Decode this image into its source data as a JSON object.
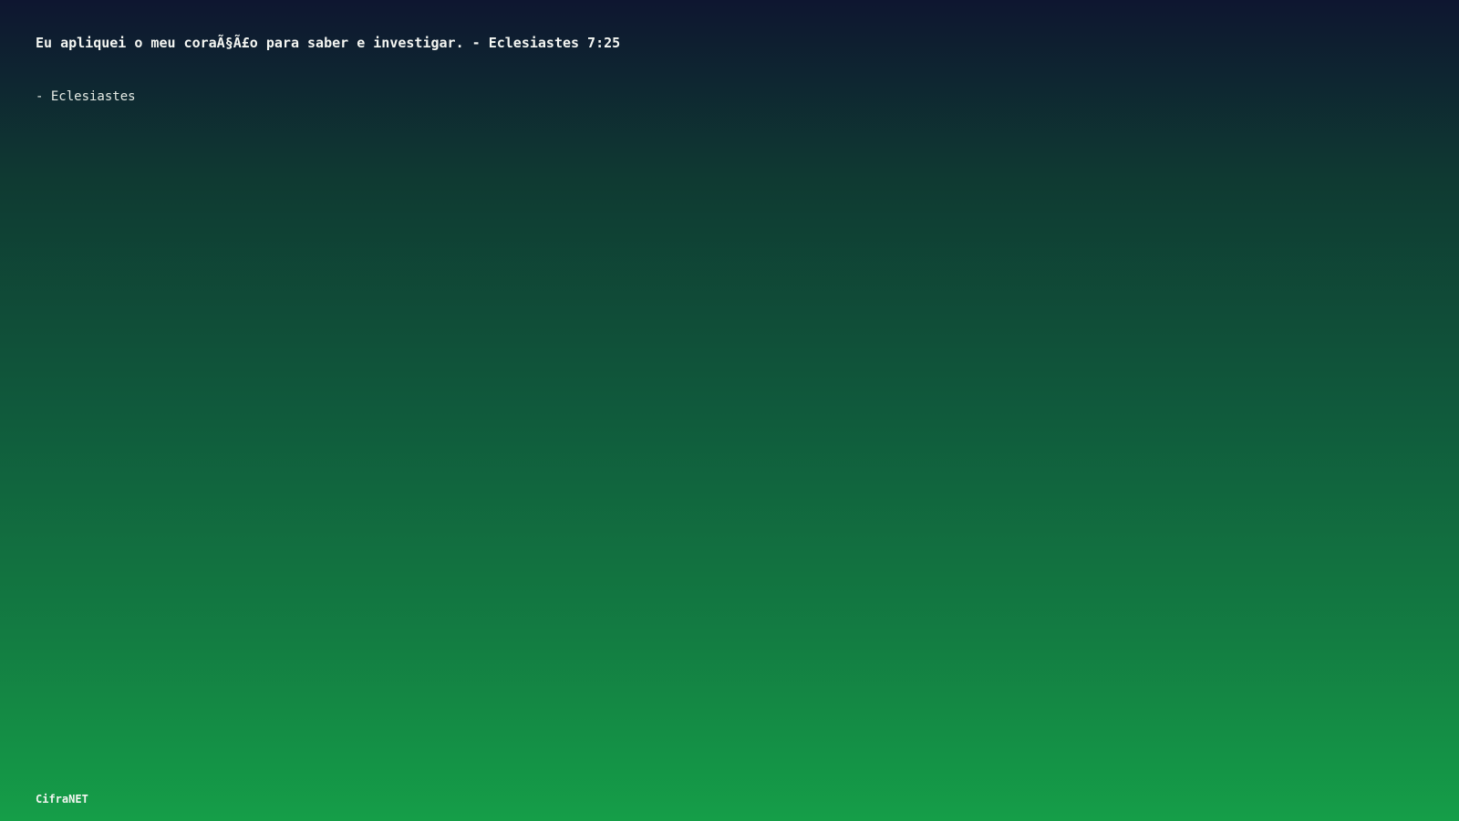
{
  "quote": {
    "text": "Eu apliquei o meu coraÃ§Ã£o para saber e investigar. - Eclesiastes 7:25",
    "author": "- Eclesiastes"
  },
  "footer": {
    "brand": "CifraNET"
  },
  "colors": {
    "gradient_top": "#0e1630",
    "gradient_bottom": "#159e48",
    "text": "#f4f6f2"
  }
}
